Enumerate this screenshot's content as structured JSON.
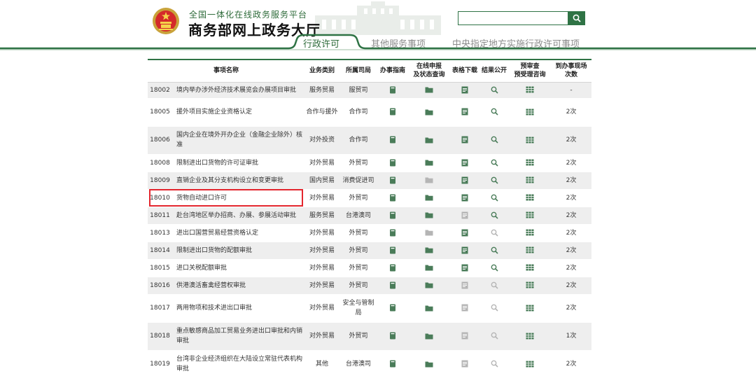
{
  "header": {
    "subtitle": "全国一体化在线政务服务平台",
    "title": "商务部网上政务大厅"
  },
  "search": {
    "placeholder": "",
    "value": ""
  },
  "tabs": [
    {
      "label": "行政许可",
      "active": true
    },
    {
      "label": "其他服务事项",
      "active": false
    },
    {
      "label": "中央指定地方实施行政许可事项",
      "active": false
    }
  ],
  "colors": {
    "brand_green": "#2f7345",
    "highlight_red": "#e3262e",
    "icon_active": "#4a7c59",
    "icon_muted": "#b5b5b5"
  },
  "table": {
    "headers": {
      "name": "事项名称",
      "category": "业务类别",
      "department": "所属司局",
      "guide": "办事指南",
      "apply_line1": "在线申报",
      "apply_line2": "及状态查询",
      "download": "表格下载",
      "result": "结果公开",
      "consult_line1": "预审查",
      "consult_line2": "预受理咨询",
      "visits_line1": "到办事现场",
      "visits_line2": "次数"
    },
    "rows": [
      {
        "id": "18002",
        "name": "境内举办涉外经济技术展览会办展项目审批",
        "category": "服务贸易",
        "department": "服贸司",
        "visits": "-",
        "apply_active": true,
        "download_active": true,
        "result_active": true,
        "height": 23
      },
      {
        "id": "18005",
        "name": "援外项目实施企业资格认定",
        "category": "合作与援外",
        "department": "合作司",
        "visits": "2次",
        "apply_active": true,
        "download_active": true,
        "result_active": true,
        "height": 40
      },
      {
        "id": "18006",
        "name": "国内企业在境外开办企业（金融企业除外）核准",
        "category": "对外投资",
        "department": "合作司",
        "visits": "2次",
        "apply_active": true,
        "download_active": true,
        "result_active": true,
        "height": 40
      },
      {
        "id": "18008",
        "name": "限制进出口货物的许可证审批",
        "category": "对外贸易",
        "department": "外贸司",
        "visits": "2次",
        "apply_active": true,
        "download_active": true,
        "result_active": true,
        "height": 25
      },
      {
        "id": "18009",
        "name": "直销企业及其分支机构设立和变更审批",
        "category": "国内贸易",
        "department": "消费促进司",
        "visits": "2次",
        "apply_active": false,
        "download_active": true,
        "result_active": true,
        "height": 25
      },
      {
        "id": "18010",
        "name": "货物自动进口许可",
        "category": "对外贸易",
        "department": "外贸司",
        "visits": "2次",
        "apply_active": true,
        "download_active": true,
        "result_active": true,
        "height": 25
      },
      {
        "id": "18011",
        "name": "赴台湾地区举办招商、办展、参展活动审批",
        "category": "服务贸易",
        "department": "台港澳司",
        "visits": "2次",
        "apply_active": true,
        "download_active": false,
        "result_active": true,
        "height": 25
      },
      {
        "id": "18013",
        "name": "进出口国营贸易经营资格认定",
        "category": "对外贸易",
        "department": "外贸司",
        "visits": "2次",
        "apply_active": false,
        "download_active": true,
        "result_active": false,
        "height": 25
      },
      {
        "id": "18014",
        "name": "限制进出口货物的配额审批",
        "category": "对外贸易",
        "department": "外贸司",
        "visits": "2次",
        "apply_active": true,
        "download_active": true,
        "result_active": true,
        "height": 25
      },
      {
        "id": "18015",
        "name": "进口关税配额审批",
        "category": "对外贸易",
        "department": "外贸司",
        "visits": "2次",
        "apply_active": true,
        "download_active": true,
        "result_active": true,
        "height": 25
      },
      {
        "id": "18016",
        "name": "供港澳活畜禽经营权审批",
        "category": "对外贸易",
        "department": "外贸司",
        "visits": "2次",
        "apply_active": true,
        "download_active": false,
        "result_active": false,
        "height": 25
      },
      {
        "id": "18017",
        "name": "两用物项和技术进出口审批",
        "category": "对外贸易",
        "department": "安全与管制局",
        "visits": "2次",
        "apply_active": true,
        "download_active": false,
        "result_active": false,
        "height": 40
      },
      {
        "id": "18018",
        "name": "重点敏感商品加工贸易业务进出口审批和内销审批",
        "category": "对外贸易",
        "department": "外贸司",
        "visits": "1次",
        "apply_active": true,
        "download_active": false,
        "result_active": false,
        "height": 40
      },
      {
        "id": "18019",
        "name": "台湾非企业经济组织在大陆设立常驻代表机构审批",
        "category": "其他",
        "department": "台港澳司",
        "visits": "2次",
        "apply_active": true,
        "download_active": false,
        "result_active": false,
        "height": 40
      }
    ],
    "highlighted_row": "18010"
  }
}
